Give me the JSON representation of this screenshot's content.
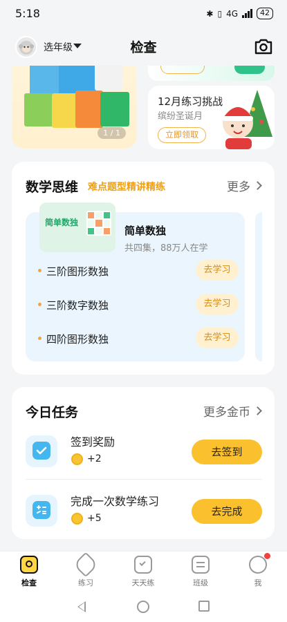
{
  "status_bar": {
    "time": "5:18",
    "network": "4G",
    "battery": "42"
  },
  "header": {
    "grade_label": "选年级",
    "title": "检查"
  },
  "banner_left": {
    "pager": "1 / 1"
  },
  "banner_right": {
    "title": "12月练习挑战",
    "subtitle": "缤纷圣诞月",
    "button": "立即领取"
  },
  "math_section": {
    "title": "数学思维",
    "subtitle": "难点题型精讲精练",
    "more": "更多",
    "course": {
      "thumb_label": "简单数独",
      "name": "简单数独",
      "meta": "共四集，88万人在学",
      "lessons": [
        {
          "name": "三阶图形数独",
          "button": "去学习"
        },
        {
          "name": "三阶数字数独",
          "button": "去学习"
        },
        {
          "name": "四阶图形数独",
          "button": "去学习"
        }
      ]
    }
  },
  "tasks_section": {
    "title": "今日任务",
    "more": "更多金币",
    "tasks": [
      {
        "name": "签到奖励",
        "reward": "+2",
        "button": "去签到"
      },
      {
        "name": "完成一次数学练习",
        "reward": "+5",
        "button": "去完成"
      }
    ]
  },
  "bottom_nav": {
    "items": [
      {
        "label": "检查",
        "active": true
      },
      {
        "label": "练习"
      },
      {
        "label": "天天练"
      },
      {
        "label": "班级"
      },
      {
        "label": "我"
      }
    ]
  },
  "colors": {
    "accent": "#fbc02d",
    "highlight": "#f0a010",
    "panel": "#eaf5fe"
  }
}
